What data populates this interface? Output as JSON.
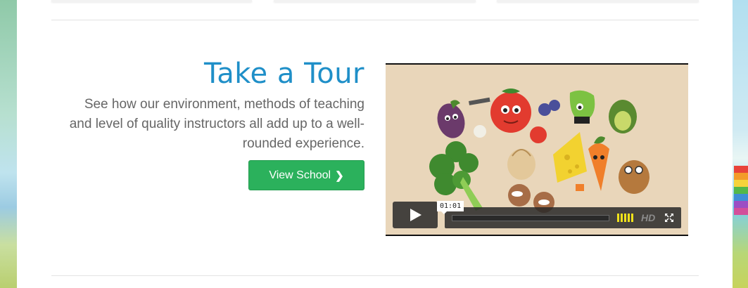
{
  "tour": {
    "title": "Take a Tour",
    "description": "See how our environment, methods of teaching and level of quality instructors all add up to a well-rounded experience.",
    "button_label": "View School",
    "button_icon": "chevron-right-icon"
  },
  "video": {
    "timecode": "01:01",
    "hd_label": "HD",
    "progress": 0,
    "volume_level": 1.0,
    "icons": [
      "play-icon",
      "volume-icon",
      "fullscreen-icon"
    ]
  },
  "colors": {
    "title": "#1f8fc8",
    "button": "#2bb15c",
    "volume": "#f0e21b",
    "text": "#666666"
  }
}
